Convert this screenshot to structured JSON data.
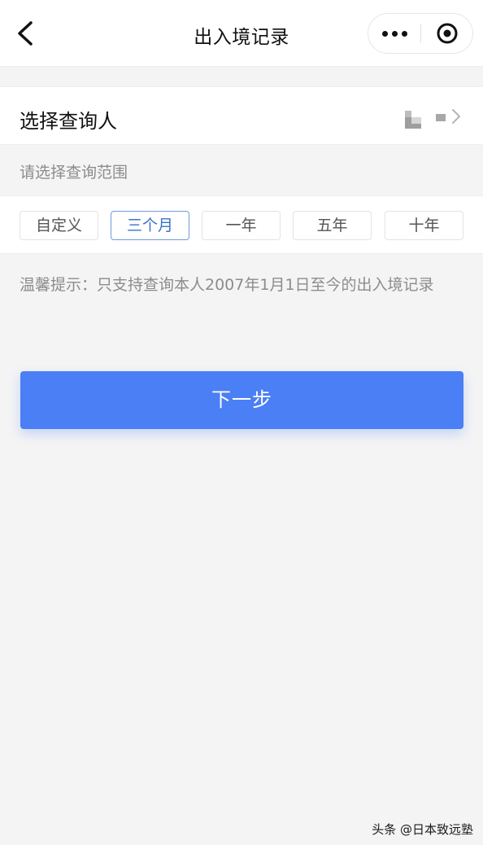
{
  "header": {
    "title": "出入境记录"
  },
  "person": {
    "label": "选择查询人"
  },
  "range": {
    "label": "请选择查询范围",
    "options": [
      "自定义",
      "三个月",
      "一年",
      "五年",
      "十年"
    ],
    "selected": "三个月"
  },
  "tip": {
    "text": "温馨提示：只支持查询本人2007年1月1日至今的出入境记录"
  },
  "actions": {
    "next_label": "下一步"
  },
  "colors": {
    "primary": "#4a7ff5",
    "selected_border": "#6e9be0",
    "background": "#f4f4f5"
  },
  "watermark": {
    "text": "头条 @日本致远塾"
  }
}
